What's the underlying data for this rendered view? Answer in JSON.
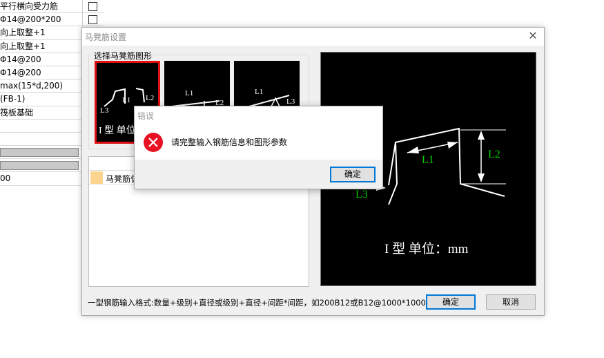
{
  "background_grid": {
    "rows": [
      "平行横向受力筋",
      "Φ14@200*200",
      "向上取整+1",
      "向上取整+1",
      "Φ14@200",
      "Φ14@200",
      "max(15*d,200)",
      "(FB-1)",
      "筏板基础",
      "",
      "",
      "",
      "",
      "00"
    ]
  },
  "main_dialog": {
    "title": "马凳筋设置",
    "close_glyph": "✕",
    "group_label": "选择马凳筋图形",
    "thumbnails": [
      {
        "labels": [
          "L1",
          "L2",
          "L3"
        ],
        "caption": "I 型 单位"
      },
      {
        "labels": [
          "L1",
          "L2"
        ]
      },
      {
        "labels": [
          "L1",
          "L3"
        ]
      }
    ],
    "list_row_label": "马凳筋信",
    "preview": {
      "label_l1": "L1",
      "label_l2": "L2",
      "label_l3": "L3",
      "caption": "I 型  单位：mm"
    },
    "hint": "一型钢筋输入格式:数量+级别+直径或级别+直径+间距*间距，如200B12或B12@1000*1000",
    "ok_label": "确定",
    "cancel_label": "取消"
  },
  "error_dialog": {
    "title": "错误",
    "message": "请完整输入钢筋信息和图形参数",
    "ok_label": "确定"
  },
  "colors": {
    "accent": "#0078d7",
    "error_icon": "#e81123",
    "selected_outline": "#e01010",
    "dim_label_green": "#00d000"
  }
}
